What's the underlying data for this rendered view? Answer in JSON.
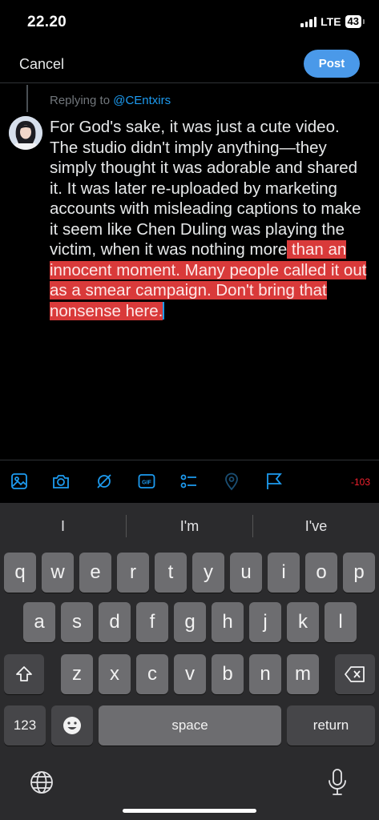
{
  "status": {
    "time": "22.20",
    "network": "LTE",
    "battery": "43"
  },
  "header": {
    "cancel_label": "Cancel",
    "post_label": "Post"
  },
  "reply": {
    "prefix": "Replying to ",
    "handle": "@CEntxirs"
  },
  "compose": {
    "text_within_limit": "For God's sake, it was just a cute video. The studio didn't imply anything—they simply thought it was adorable and shared it. It was later re-uploaded by marketing accounts with misleading captions to make it seem like Chen Duling was playing the victim, when it was nothing more",
    "text_over_limit": " than an innocent moment. Many people called it out as a smear campaign. Don't bring that nonsense here."
  },
  "toolbar": {
    "icons": [
      "image-icon",
      "camera-icon",
      "sparkle-icon",
      "gif-icon",
      "poll-icon",
      "location-icon",
      "flag-icon"
    ],
    "char_count": "-103"
  },
  "keyboard": {
    "suggestions": [
      "I",
      "I'm",
      "I've"
    ],
    "row1": [
      "q",
      "w",
      "e",
      "r",
      "t",
      "y",
      "u",
      "i",
      "o",
      "p"
    ],
    "row2": [
      "a",
      "s",
      "d",
      "f",
      "g",
      "h",
      "j",
      "k",
      "l"
    ],
    "row3": [
      "z",
      "x",
      "c",
      "v",
      "b",
      "n",
      "m"
    ],
    "numbers_label": "123",
    "space_label": "space",
    "return_label": "return"
  },
  "colors": {
    "accent": "#1d9bf0",
    "post_button": "#4a99e9",
    "over_limit": "#d93a3a"
  }
}
